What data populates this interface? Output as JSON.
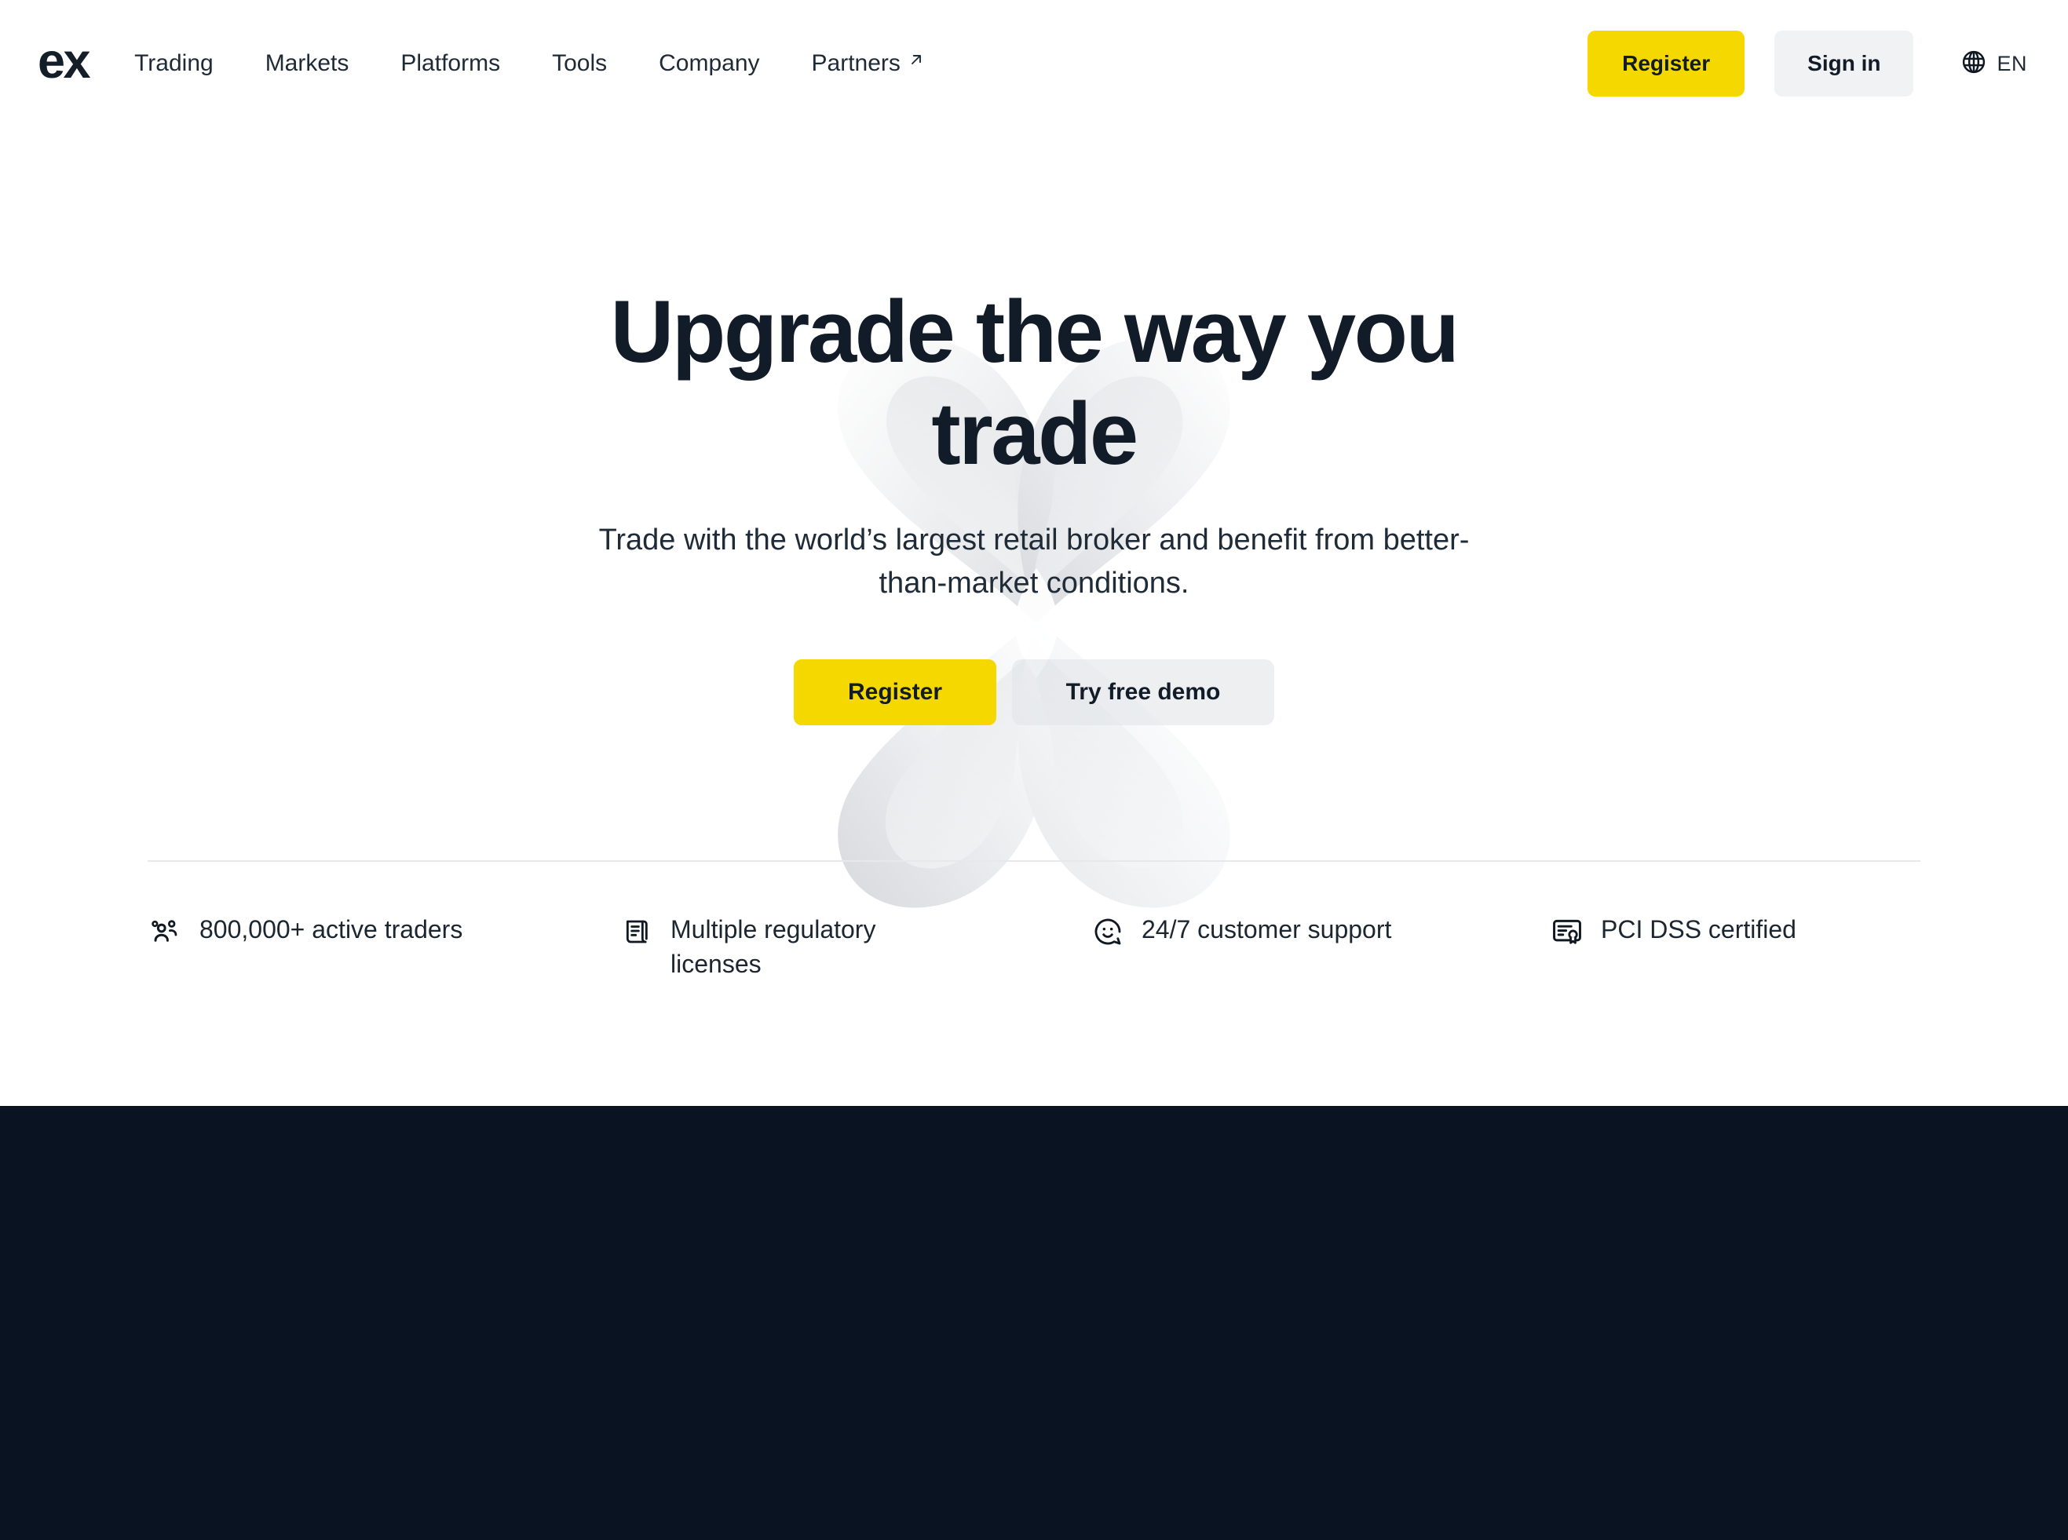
{
  "brand": {
    "logo_text": "ex",
    "accent_yellow": "#F5D800",
    "dark_navy": "#0A1322",
    "text_dark": "#121C28"
  },
  "header": {
    "nav": [
      {
        "label": "Trading",
        "external": false
      },
      {
        "label": "Markets",
        "external": false
      },
      {
        "label": "Platforms",
        "external": false
      },
      {
        "label": "Tools",
        "external": false
      },
      {
        "label": "Company",
        "external": false
      },
      {
        "label": "Partners",
        "external": true
      }
    ],
    "register_label": "Register",
    "signin_label": "Sign in",
    "language": {
      "icon": "globe-icon",
      "code": "EN"
    },
    "external_link_icon": "arrow-up-right-icon"
  },
  "hero": {
    "title": "Upgrade the way you trade",
    "subtitle": "Trade with the world’s largest retail broker and benefit from better-than-market conditions.",
    "primary_cta": "Register",
    "secondary_cta": "Try free demo",
    "background_art": "x-ribbon-knot-3d"
  },
  "features": [
    {
      "icon": "users-group-icon",
      "label": "800,000+ active traders"
    },
    {
      "icon": "scroll-document-icon",
      "label": "Multiple regulatory licenses"
    },
    {
      "icon": "smiley-face-icon",
      "label": "24/7 customer support"
    },
    {
      "icon": "certificate-seal-icon",
      "label": "PCI DSS certified"
    }
  ]
}
